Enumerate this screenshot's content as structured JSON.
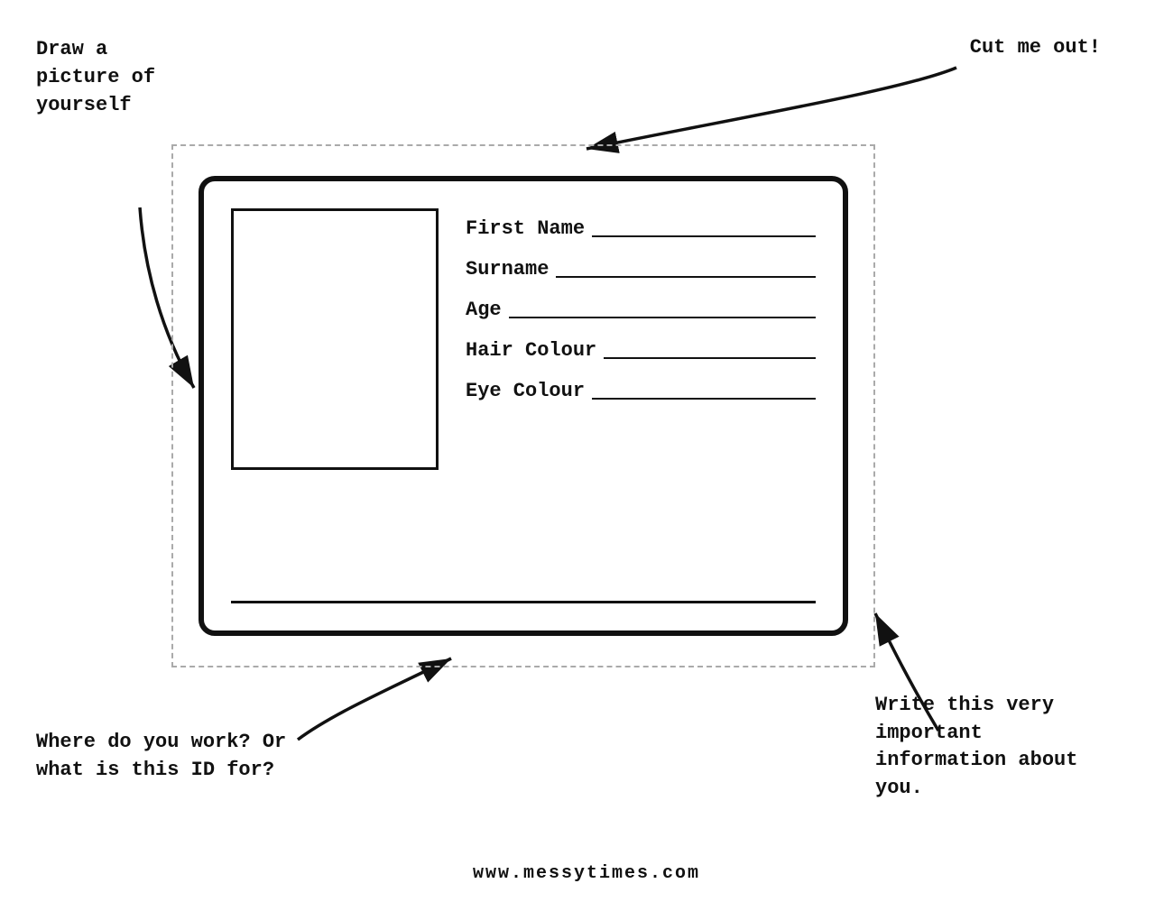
{
  "annotations": {
    "top_left": "Draw a\npicture of\nyourself",
    "top_right": "Cut me out!",
    "bottom_left": "Where do you work? Or\nwhat is this ID for?",
    "bottom_right": "Write this very important\ninformation about you.",
    "website": "www.messytimes.com"
  },
  "id_card": {
    "fields": [
      {
        "label": "First Name"
      },
      {
        "label": "Surname"
      },
      {
        "label": "Age"
      },
      {
        "label": "Hair Colour"
      },
      {
        "label": "Eye Colour"
      }
    ]
  }
}
